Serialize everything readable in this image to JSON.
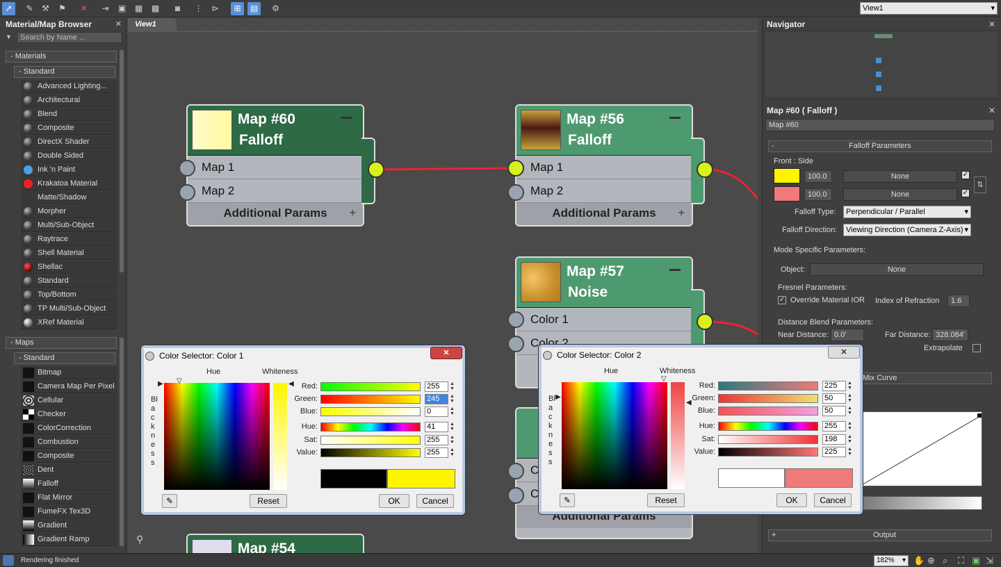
{
  "toolbar": {
    "view_select": "View1"
  },
  "browser": {
    "title": "Material/Map Browser",
    "search_placeholder": "Search by Name ...",
    "materials_label": "- Materials",
    "materials_standard": "- Standard",
    "materials": [
      "Advanced Lighting...",
      "Architectural",
      "Blend",
      "Composite",
      "DirectX Shader",
      "Double Sided",
      "Ink 'n Paint",
      "Krakatoa Material",
      "Matte/Shadow",
      "Morpher",
      "Multi/Sub-Object",
      "Raytrace",
      "Shell Material",
      "Shellac",
      "Standard",
      "Top/Bottom",
      "TP Multi/Sub-Object",
      "XRef Material"
    ],
    "maps_label": "- Maps",
    "maps_standard": "- Standard",
    "maps": [
      "Bitmap",
      "Camera Map Per Pixel",
      "Cellular",
      "Checker",
      "ColorCorrection",
      "Combustion",
      "Composite",
      "Dent",
      "Falloff",
      "Flat Mirror",
      "FumeFX Tex3D",
      "Gradient",
      "Gradient Ramp"
    ]
  },
  "canvas": {
    "tab": "View1",
    "node60": {
      "title": "Map #60",
      "type": "Falloff",
      "slot1": "Map 1",
      "slot2": "Map 2",
      "params": "Additional Params"
    },
    "node56": {
      "title": "Map #56",
      "type": "Falloff",
      "slot1": "Map 1",
      "slot2": "Map 2",
      "params": "Additional Params"
    },
    "node57": {
      "title": "Map #57",
      "type": "Noise",
      "slot1": "Color 1",
      "slot2": "Color 2"
    },
    "node54": {
      "title": "Map #54"
    },
    "partial_params": "Additional Params",
    "partial_slot": "C"
  },
  "navigator": {
    "title": "Navigator"
  },
  "params": {
    "title": "Map #60  ( Falloff )",
    "name_value": "Map #60",
    "rollout": "Falloff Parameters",
    "front_side": "Front : Side",
    "front_value": "100.0",
    "side_value": "100.0",
    "none1": "None",
    "none2": "None",
    "falloff_type_label": "Falloff Type:",
    "falloff_type": "Perpendicular / Parallel",
    "falloff_dir_label": "Falloff Direction:",
    "falloff_dir": "Viewing Direction (Camera Z-Axis)",
    "mode_label": "Mode Specific Parameters:",
    "object_label": "Object:",
    "object_value": "None",
    "fresnel_label": "Fresnel Parameters:",
    "override_ior": "Override Material IOR",
    "ior_label": "Index of Refraction",
    "ior_value": "1.6",
    "distance_label": "Distance Blend Parameters:",
    "near_label": "Near Distance:",
    "near_value": "0.0'",
    "far_label": "Far Distance:",
    "far_value": "328.084'",
    "extrapolate": "Extrapolate",
    "mix_curve": "Mix Curve",
    "output": "Output"
  },
  "dialog1": {
    "title": "Color Selector: Color 1",
    "hue_label": "Hue",
    "whiteness_label": "Whiteness",
    "blackness": "Blackness",
    "red": "Red:",
    "green": "Green:",
    "blue": "Blue:",
    "hue": "Hue:",
    "sat": "Sat:",
    "value": "Value:",
    "red_v": "255",
    "green_v": "245",
    "blue_v": "0",
    "hue_v": "41",
    "sat_v": "255",
    "value_v": "255",
    "reset": "Reset",
    "ok": "OK",
    "cancel": "Cancel",
    "old_color": "#000000",
    "new_color": "#fff500"
  },
  "dialog2": {
    "title": "Color Selector: Color 2",
    "hue_label": "Hue",
    "whiteness_label": "Whiteness",
    "blackness": "Blackness",
    "red": "Red:",
    "green": "Green:",
    "blue": "Blue:",
    "hue": "Hue:",
    "sat": "Sat:",
    "value": "Value:",
    "red_v": "225",
    "green_v": "50",
    "blue_v": "50",
    "hue_v": "255",
    "sat_v": "198",
    "value_v": "225",
    "reset": "Reset",
    "ok": "OK",
    "cancel": "Cancel",
    "old_color": "#ffffff",
    "new_color": "#f07a7a"
  },
  "status": {
    "text": "Rendering finished",
    "zoom": "182%"
  }
}
